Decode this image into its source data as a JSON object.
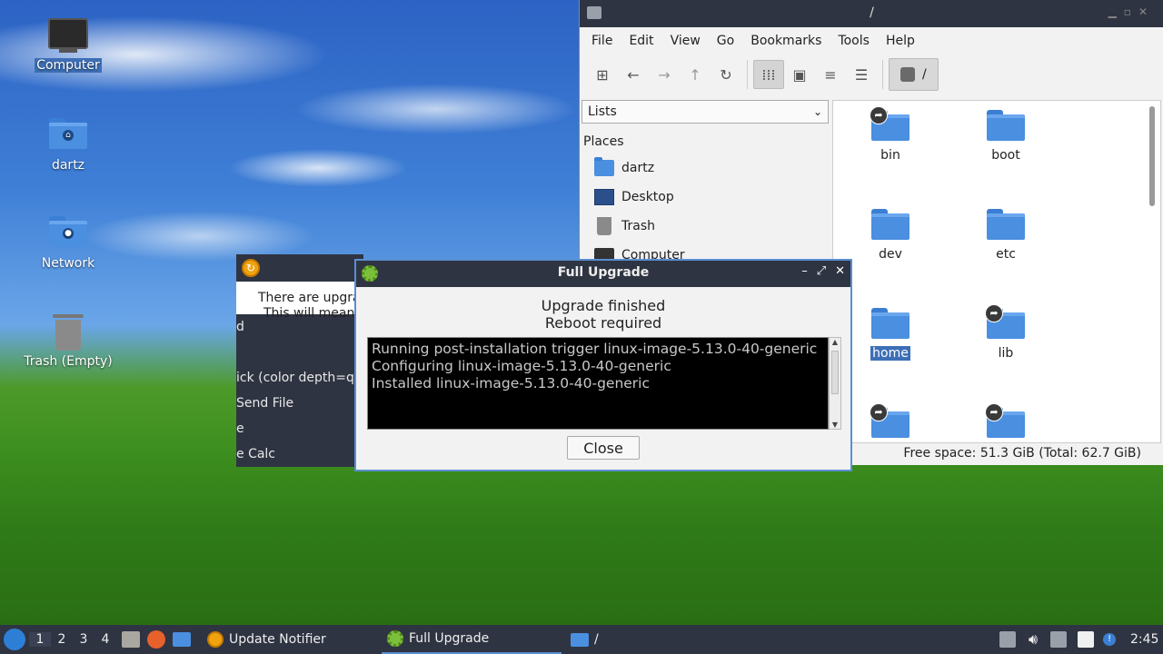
{
  "desktop": {
    "icons": [
      {
        "label": "Computer"
      },
      {
        "label": "dartz"
      },
      {
        "label": "Network"
      },
      {
        "label": "Trash (Empty)"
      }
    ]
  },
  "notifier": {
    "text_line1": "There are upgra",
    "text_line2": "This will mean",
    "list": [
      "d",
      "",
      "ick (color depth=q1",
      "Send File",
      "e",
      "e Calc"
    ]
  },
  "file_manager": {
    "title": "/",
    "menu": [
      "File",
      "Edit",
      "View",
      "Go",
      "Bookmarks",
      "Tools",
      "Help"
    ],
    "path_label": "/",
    "side_combo": "Lists",
    "places_heading": "Places",
    "places": [
      {
        "label": "dartz",
        "icon": "home-folder-icon"
      },
      {
        "label": "Desktop",
        "icon": "desktop-icon"
      },
      {
        "label": "Trash",
        "icon": "trash-icon"
      },
      {
        "label": "Computer",
        "icon": "computer-icon"
      }
    ],
    "files": [
      {
        "label": "bin",
        "symlink": true
      },
      {
        "label": "boot",
        "symlink": false
      },
      {
        "label": "dev",
        "symlink": false
      },
      {
        "label": "etc",
        "symlink": false
      },
      {
        "label": "home",
        "symlink": false,
        "selected": true
      },
      {
        "label": "lib",
        "symlink": true
      },
      {
        "label": "",
        "symlink": true
      },
      {
        "label": "",
        "symlink": true
      }
    ],
    "status": "Free space: 51.3 GiB (Total: 62.7 GiB)"
  },
  "dialog": {
    "title": "Full Upgrade",
    "message_line1": "Upgrade finished",
    "message_line2": "Reboot required",
    "log": [
      "Running post-installation trigger linux-image-5.13.0-40-generic",
      "Configuring linux-image-5.13.0-40-generic",
      "Installed linux-image-5.13.0-40-generic"
    ],
    "close_label": "Close"
  },
  "taskbar": {
    "workspaces": [
      "1",
      "2",
      "3",
      "4"
    ],
    "tasks": [
      {
        "label": "Update Notifier"
      },
      {
        "label": "Full Upgrade"
      },
      {
        "label": "/"
      }
    ],
    "clock": "2:45"
  }
}
